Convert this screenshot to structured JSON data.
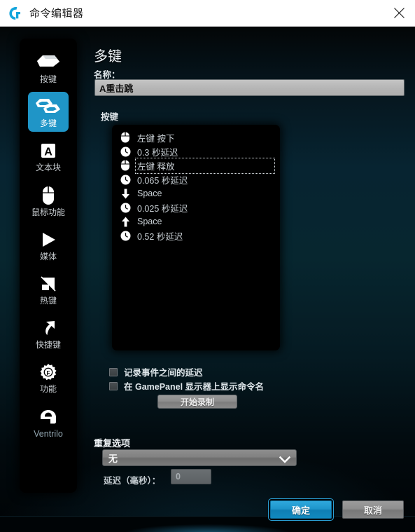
{
  "titlebar": {
    "title": "命令编辑器",
    "logo_icon": "logitech-g-logo",
    "close_icon": "close-icon"
  },
  "sidebar": {
    "items": [
      {
        "label": "按键",
        "icon": "single-key-icon",
        "active": false
      },
      {
        "label": "多键",
        "icon": "multi-key-icon",
        "active": true
      },
      {
        "label": "文本块",
        "icon": "text-block-icon",
        "active": false
      },
      {
        "label": "鼠标功能",
        "icon": "mouse-icon",
        "active": false
      },
      {
        "label": "媒体",
        "icon": "play-icon",
        "active": false
      },
      {
        "label": "热键",
        "icon": "hotkey-icon",
        "active": false
      },
      {
        "label": "快捷键",
        "icon": "shortcut-arrow-icon",
        "active": false
      },
      {
        "label": "功能",
        "icon": "gear-f-icon",
        "active": false
      },
      {
        "label": "Ventrilo",
        "icon": "headset-icon",
        "active": false
      }
    ]
  },
  "main": {
    "page_title": "多键",
    "name_label": "名称：",
    "name_value": "A重击跳",
    "name_placeholder": "",
    "keys_label": "按键",
    "events": [
      {
        "icon": "mouse-icon",
        "text": "左键 按下",
        "focused": false
      },
      {
        "icon": "clock-icon",
        "text": "0.3 秒延迟",
        "focused": false
      },
      {
        "icon": "mouse-icon",
        "text": "左键 释放",
        "focused": true
      },
      {
        "icon": "clock-icon",
        "text": "0.065 秒延迟",
        "focused": false
      },
      {
        "icon": "arrow-down-icon",
        "text": "Space",
        "focused": false
      },
      {
        "icon": "clock-icon",
        "text": "0.025 秒延迟",
        "focused": false
      },
      {
        "icon": "arrow-up-icon",
        "text": "Space",
        "focused": false
      },
      {
        "icon": "clock-icon",
        "text": "0.52 秒延迟",
        "focused": false
      }
    ],
    "checkbox_record_delay": {
      "label": "记录事件之间的延迟",
      "checked": false
    },
    "checkbox_gamepanel": {
      "label": "在 GamePanel 显示器上显示命令名",
      "checked": false
    },
    "record_button": "开始录制",
    "repeat_title": "重复选项",
    "repeat_selected": "无",
    "repeat_options": [
      "无"
    ],
    "repeat_chevron_icon": "chevron-down-icon",
    "delay_label": "延迟（毫秒）：",
    "delay_value": "0",
    "ok_button": "确定",
    "cancel_button": "取消"
  },
  "colors": {
    "accent_blue": "#1f95c7",
    "panel_black": "#000000",
    "titlebar_white": "#ffffff",
    "input_gray": "#b5b5b5",
    "bg_teal": "#07262f"
  }
}
